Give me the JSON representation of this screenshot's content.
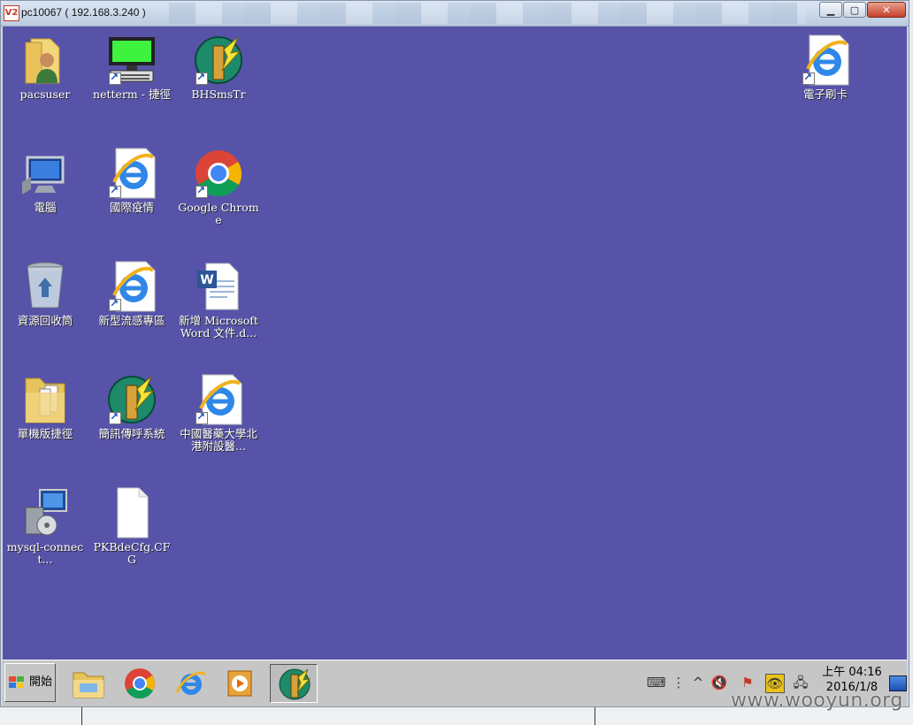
{
  "window": {
    "title_icon": "V2",
    "title": "pc10067 ( 192.168.3.240 )",
    "minimize": "▁",
    "maximize": "▢",
    "close": "✕"
  },
  "desktop": {
    "background": "#5753a8",
    "icons": [
      {
        "label": "pacsuser",
        "icon": "user-folder-icon",
        "shortcut": false
      },
      {
        "label": "netterm - 捷徑",
        "icon": "terminal-computer-icon",
        "shortcut": true
      },
      {
        "label": "BHSmsTr",
        "icon": "pager-lightning-icon",
        "shortcut": true
      },
      {
        "label": "電子刷卡",
        "icon": "internet-explorer-icon",
        "shortcut": true
      },
      {
        "label": "電腦",
        "icon": "computer-icon",
        "shortcut": false
      },
      {
        "label": "國際疫情",
        "icon": "internet-explorer-icon",
        "shortcut": true
      },
      {
        "label": "Google Chrome",
        "icon": "chrome-icon",
        "shortcut": true
      },
      {
        "label": "資源回收筒",
        "icon": "recycle-bin-icon",
        "shortcut": false
      },
      {
        "label": "新型流感專區",
        "icon": "internet-explorer-icon",
        "shortcut": true
      },
      {
        "label": "新增 Microsoft Word 文件.d...",
        "icon": "word-document-icon",
        "shortcut": false
      },
      {
        "label": "單機版捷徑",
        "icon": "folder-icon",
        "shortcut": false
      },
      {
        "label": "簡訊傳呼系統",
        "icon": "pager-lightning-icon",
        "shortcut": true
      },
      {
        "label": "中國醫藥大學北港附設醫...",
        "icon": "internet-explorer-icon",
        "shortcut": true
      },
      {
        "label": "mysql-connect...",
        "icon": "installer-icon",
        "shortcut": false
      },
      {
        "label": "PKBdeCfg.CFG",
        "icon": "blank-file-icon",
        "shortcut": false
      }
    ]
  },
  "taskbar": {
    "start_label": "開始",
    "apps": [
      {
        "icon": "file-explorer-icon",
        "active": false
      },
      {
        "icon": "chrome-icon",
        "active": false
      },
      {
        "icon": "internet-explorer-icon",
        "active": false
      },
      {
        "icon": "media-player-icon",
        "active": false
      },
      {
        "icon": "pager-lightning-icon",
        "active": true
      }
    ],
    "tray": {
      "keyboard": "⌨",
      "network_small": "⋮",
      "chevron": "^",
      "volume_muted": "🔇",
      "flag": "⚑",
      "eye": "👁",
      "network": "🖧"
    },
    "clock_time": "上午 04:16",
    "clock_date": "2016/1/8"
  },
  "watermark": "www.wooyun.org"
}
